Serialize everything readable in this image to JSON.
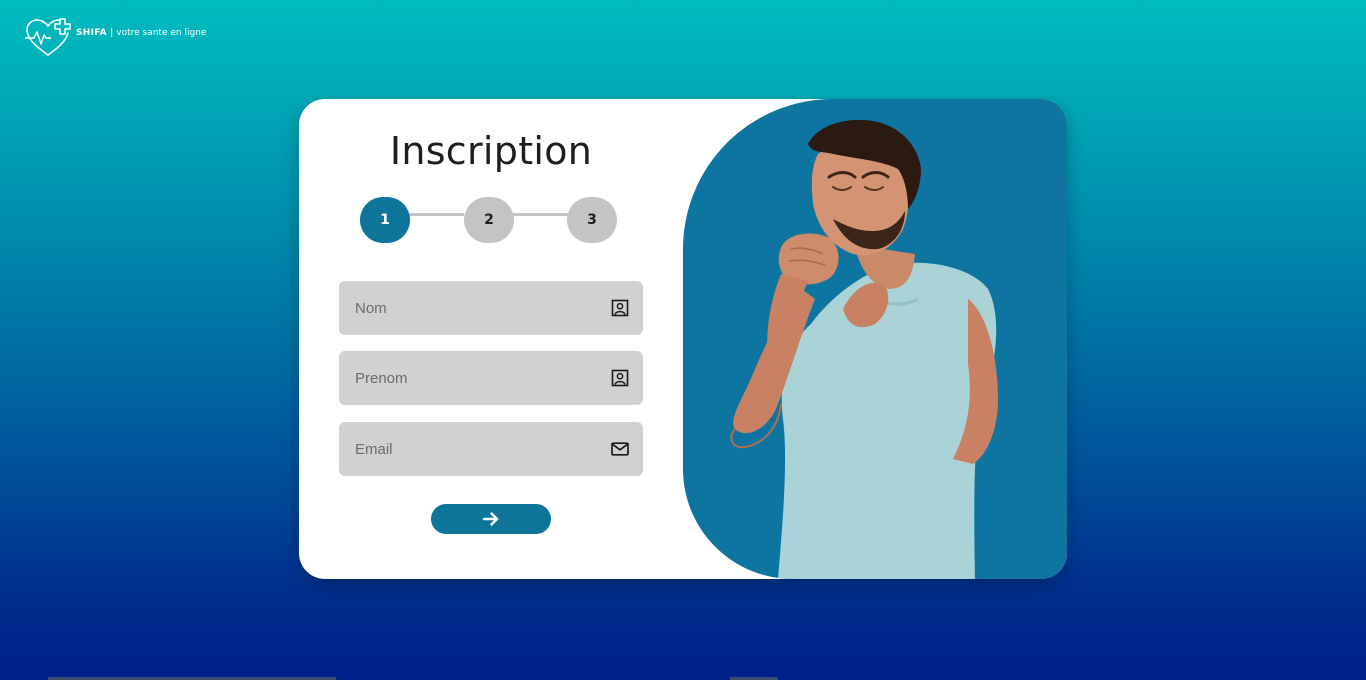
{
  "brand": {
    "name": "SHIFA",
    "separator": "|",
    "tagline": "votre sante en ligne",
    "logo_icon": "heart-pulse-cross-icon"
  },
  "form": {
    "title": "Inscription",
    "steps": [
      {
        "label": "1",
        "active": true
      },
      {
        "label": "2",
        "active": false
      },
      {
        "label": "3",
        "active": false
      }
    ],
    "fields": {
      "nom": {
        "placeholder": "Nom",
        "value": "",
        "icon": "contact-card-icon"
      },
      "prenom": {
        "placeholder": "Prenom",
        "value": "",
        "icon": "contact-card-icon"
      },
      "email": {
        "placeholder": "Email",
        "value": "",
        "icon": "envelope-icon"
      }
    },
    "submit_icon": "arrow-right-icon"
  },
  "colors": {
    "accent": "#0e7499",
    "field_bg": "#d1d1d1",
    "step_inactive": "#c4c4c4",
    "gradient_top": "#00bcbf",
    "gradient_bottom": "#00208a"
  },
  "illustration": {
    "subject": "man-coughing-photo"
  }
}
